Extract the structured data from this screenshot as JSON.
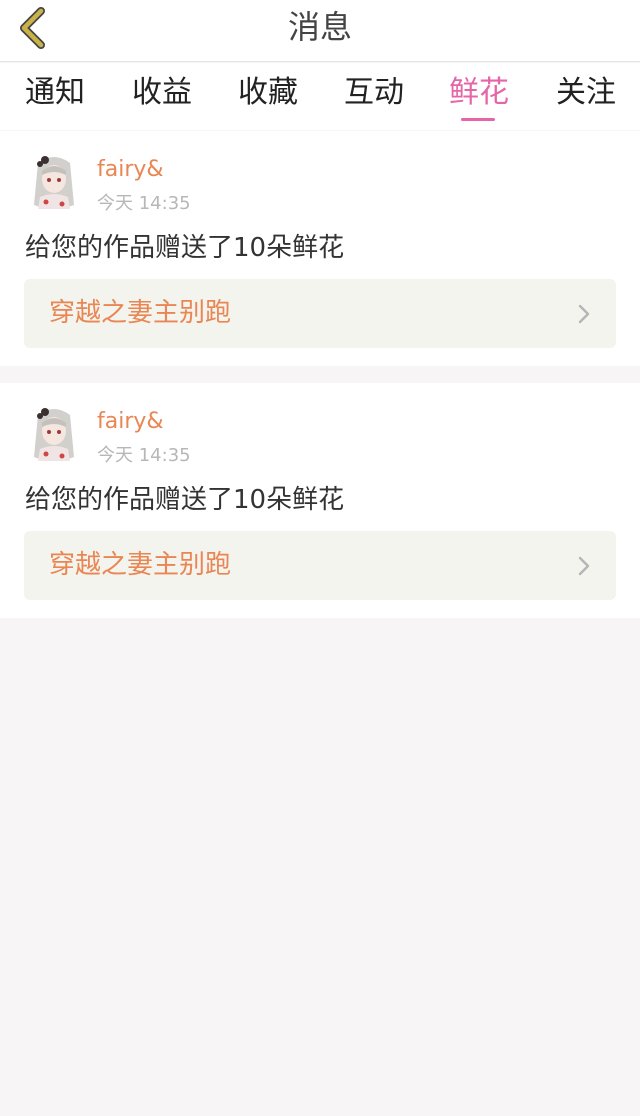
{
  "header": {
    "title": "消息"
  },
  "tabs": [
    {
      "label": "通知",
      "active": false
    },
    {
      "label": "收益",
      "active": false
    },
    {
      "label": "收藏",
      "active": false
    },
    {
      "label": "互动",
      "active": false
    },
    {
      "label": "鲜花",
      "active": true
    },
    {
      "label": "关注",
      "active": false
    }
  ],
  "messages": [
    {
      "username": "fairy&",
      "time": "今天 14:35",
      "text": "给您的作品赠送了10朵鲜花",
      "book_title": "穿越之妻主别跑",
      "avatar_icon": "anime-girl-avatar"
    },
    {
      "username": "fairy&",
      "time": "今天 14:35",
      "text": "给您的作品赠送了10朵鲜花",
      "book_title": "穿越之妻主别跑",
      "avatar_icon": "anime-girl-avatar"
    }
  ],
  "colors": {
    "accent_pink": "#e565a7",
    "link_orange": "#e98653",
    "back_icon_yellow": "#c9b247"
  }
}
